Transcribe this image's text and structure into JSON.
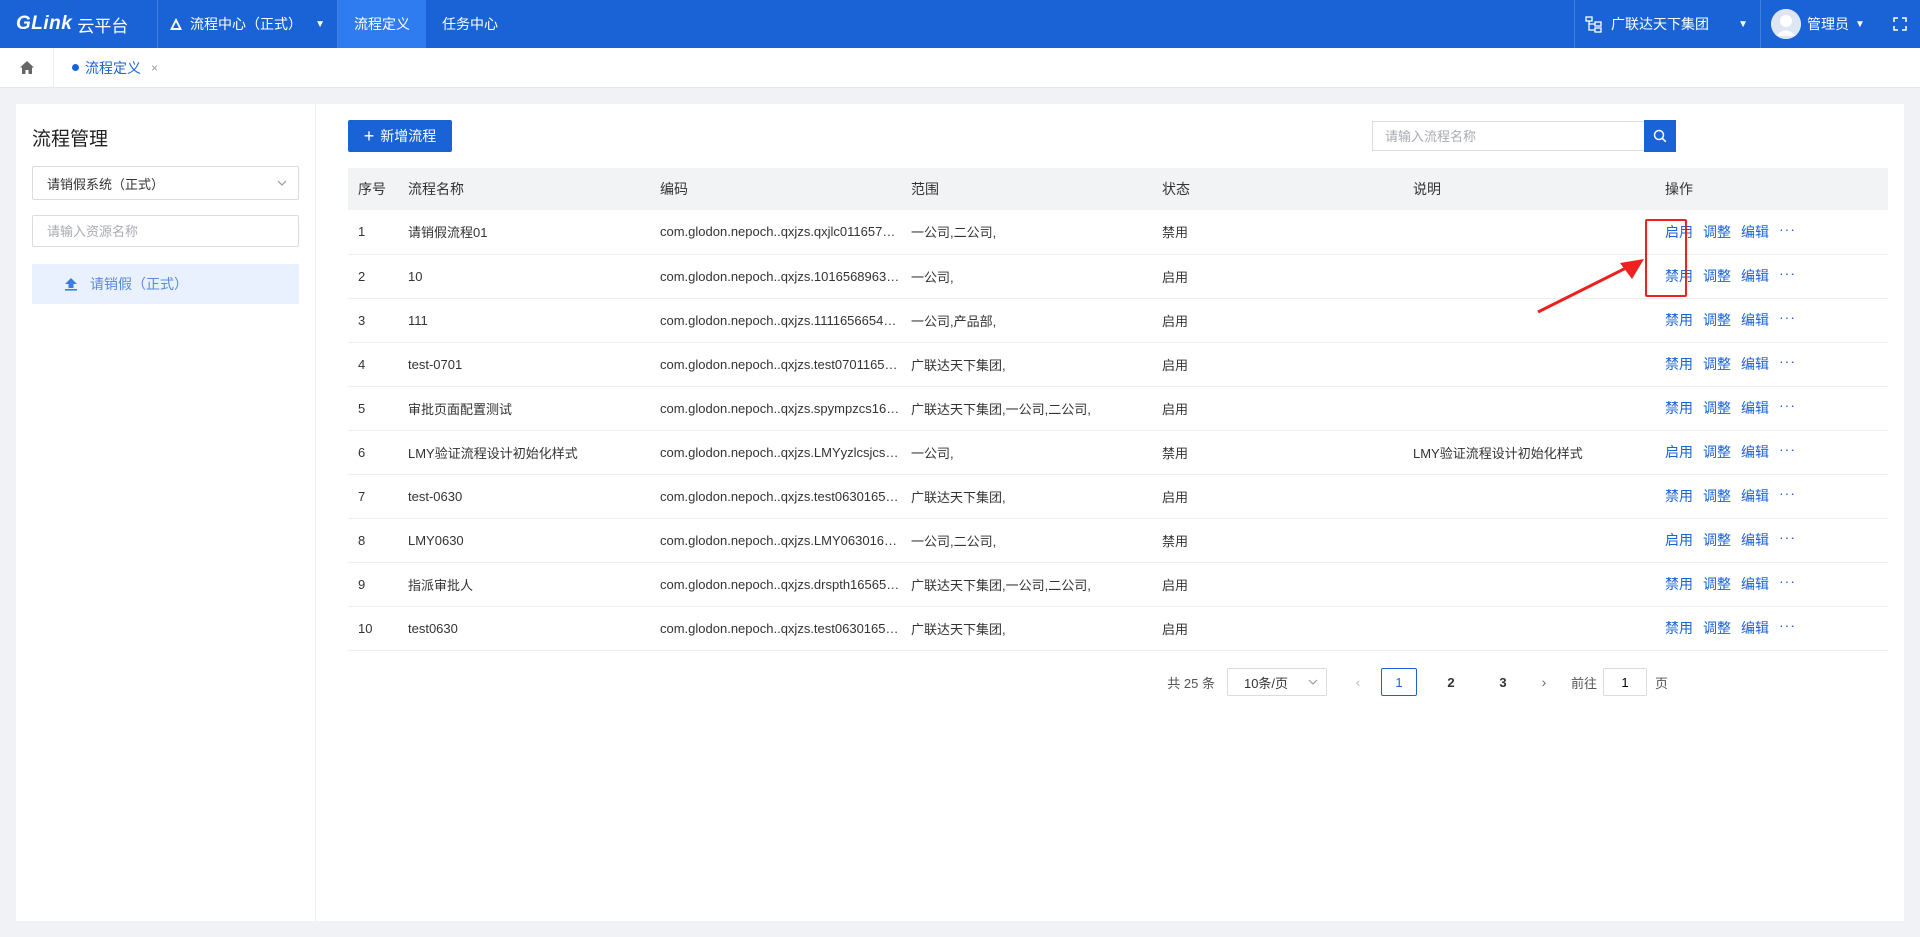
{
  "topbar": {
    "brand": "GLink",
    "brand_sub": "云平台",
    "app_switch": "流程中心（正式）",
    "nav": [
      "流程定义",
      "任务中心"
    ],
    "org": "广联达天下集团",
    "user": "管理员"
  },
  "tabs": [
    {
      "label": "流程定义",
      "close": "×"
    }
  ],
  "sidebar": {
    "title": "流程管理",
    "system_select": "请销假系统（正式）",
    "resource_search_placeholder": "请输入资源名称",
    "tree_item": "请销假（正式）"
  },
  "toolbar": {
    "add_label": "新增流程",
    "add_plus": "+",
    "search_placeholder": "请输入流程名称"
  },
  "table": {
    "columns": [
      "序号",
      "流程名称",
      "编码",
      "范围",
      "状态",
      "说明",
      "操作"
    ],
    "rows": [
      {
        "no": "1",
        "name": "请销假流程01",
        "code": "com.glodon.nepoch..qxjzs.qxjlc01165770...",
        "scope": "一公司,二公司,",
        "status": "禁用",
        "desc": "",
        "toggle": "启用"
      },
      {
        "no": "2",
        "name": "10",
        "code": "com.glodon.nepoch..qxjzs.101656896327...",
        "scope": "一公司,",
        "status": "启用",
        "desc": "",
        "toggle": "禁用"
      },
      {
        "no": "3",
        "name": "111",
        "code": "com.glodon.nepoch..qxjzs.111165665470...",
        "scope": "一公司,产品部,",
        "status": "启用",
        "desc": "",
        "toggle": "禁用"
      },
      {
        "no": "4",
        "name": "test-0701",
        "code": "com.glodon.nepoch..qxjzs.test070116566...",
        "scope": "广联达天下集团,",
        "status": "启用",
        "desc": "",
        "toggle": "禁用"
      },
      {
        "no": "5",
        "name": "审批页面配置测试",
        "code": "com.glodon.nepoch..qxjzs.spympzcs1656...",
        "scope": "广联达天下集团,一公司,二公司,",
        "status": "启用",
        "desc": "",
        "toggle": "禁用"
      },
      {
        "no": "6",
        "name": "LMY验证流程设计初始化样式",
        "code": "com.glodon.nepoch..qxjzs.LMYyzlcsjcshys...",
        "scope": "一公司,",
        "status": "禁用",
        "desc": "LMY验证流程设计初始化样式",
        "toggle": "启用"
      },
      {
        "no": "7",
        "name": "test-0630",
        "code": "com.glodon.nepoch..qxjzs.test063016565...",
        "scope": "广联达天下集团,",
        "status": "启用",
        "desc": "",
        "toggle": "禁用"
      },
      {
        "no": "8",
        "name": "LMY0630",
        "code": "com.glodon.nepoch..qxjzs.LMY06301656...",
        "scope": "一公司,二公司,",
        "status": "禁用",
        "desc": "",
        "toggle": "启用"
      },
      {
        "no": "9",
        "name": "指派审批人",
        "code": "com.glodon.nepoch..qxjzs.drspth1656578...",
        "scope": "广联达天下集团,一公司,二公司,",
        "status": "启用",
        "desc": "",
        "toggle": "禁用"
      },
      {
        "no": "10",
        "name": "test0630",
        "code": "com.glodon.nepoch..qxjzs.test063016565...",
        "scope": "广联达天下集团,",
        "status": "启用",
        "desc": "",
        "toggle": "禁用"
      }
    ],
    "op_adjust": "调整",
    "op_edit": "编辑",
    "op_more": "···"
  },
  "pager": {
    "total": "共 25 条",
    "page_size": "10条/页",
    "prev": "‹",
    "pages": [
      "1",
      "2",
      "3"
    ],
    "current": "1",
    "next": "›",
    "goto_label": "前往",
    "goto_value": "1",
    "page_suffix": "页"
  },
  "colors": {
    "primary": "#1a63d6",
    "annotation": "#f02020"
  }
}
